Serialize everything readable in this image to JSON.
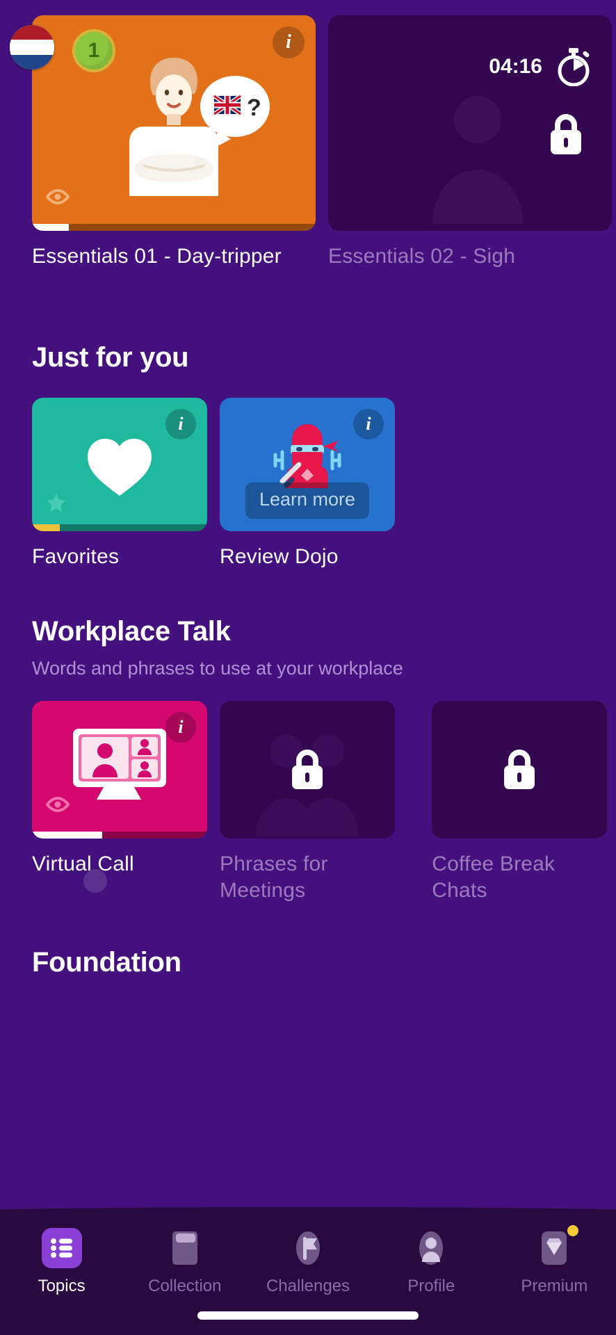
{
  "theme": {
    "bg": "#43107D",
    "hero_orange": "#E2711A",
    "locked_card": "#33064F",
    "teal": "#1FB9A0",
    "blue": "#2672CE",
    "pink": "#D4086F",
    "tabbar_bg": "#290A40",
    "accent_purple": "#8A3FD6",
    "locked_text": "#9B7BBE",
    "premium_dot": "#F5CB3A"
  },
  "hero": {
    "cards": [
      {
        "title": "Essentials 01 - Day-tripper",
        "locked": false,
        "info_label": "i",
        "level_number": "1",
        "flag": "netherlands-flag",
        "speech_flag": "uk-flag",
        "speech_text": "?",
        "progress_percent": 13,
        "eye_icon": "eye-icon"
      },
      {
        "title": "Essentials 02 - Sigh",
        "locked": true,
        "timer": "04:16",
        "timer_icon": "stopwatch-icon",
        "lock_icon": "lock-icon"
      }
    ]
  },
  "just_for_you": {
    "heading": "Just for you",
    "cards": [
      {
        "title": "Favorites",
        "info_label": "i",
        "icon": "heart-icon",
        "badge_icon": "star-icon",
        "progress_percent": 16,
        "progress_color": "#F0C23C"
      },
      {
        "title": "Review Dojo",
        "info_label": "i",
        "icon": "ninja-icon",
        "button_label": "Learn more"
      }
    ]
  },
  "workplace_talk": {
    "heading": "Workplace Talk",
    "subheading": "Words and phrases to use at your workplace",
    "cards": [
      {
        "title": "Virtual Call",
        "locked": false,
        "info_label": "i",
        "icon": "monitor-video-call-icon",
        "eye_icon": "eye-icon",
        "progress_percent": 40
      },
      {
        "title": "Phrases for Meetings",
        "locked": true,
        "lock_icon": "lock-icon"
      },
      {
        "title": "Coffee Break Chats",
        "locked": true,
        "lock_icon": "lock-icon"
      }
    ]
  },
  "foundation": {
    "heading": "Foundation"
  },
  "tabbar": {
    "items": [
      {
        "label": "Topics",
        "icon": "list-icon",
        "active": true
      },
      {
        "label": "Collection",
        "icon": "book-icon",
        "active": false
      },
      {
        "label": "Challenges",
        "icon": "flag-icon",
        "active": false
      },
      {
        "label": "Profile",
        "icon": "person-icon",
        "active": false
      },
      {
        "label": "Premium",
        "icon": "diamond-icon",
        "active": false,
        "badge": true
      }
    ]
  }
}
